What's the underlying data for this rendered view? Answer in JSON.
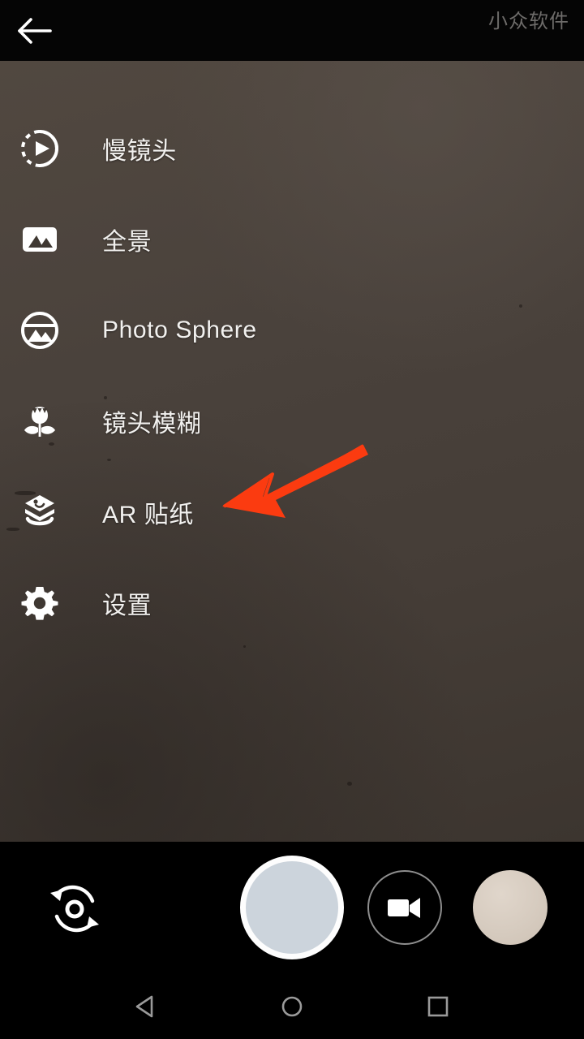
{
  "app": {
    "name": "Camera",
    "screen": "mode-menu"
  },
  "topbar": {
    "back_icon": "arrow-left-icon",
    "watermark": "小众软件"
  },
  "menu": {
    "items": [
      {
        "label": "慢镜头",
        "icon": "slow-motion-icon",
        "name": "menu-item-slow-motion"
      },
      {
        "label": "全景",
        "icon": "panorama-icon",
        "name": "menu-item-panorama"
      },
      {
        "label": "Photo Sphere",
        "icon": "photo-sphere-icon",
        "name": "menu-item-photo-sphere"
      },
      {
        "label": "镜头模糊",
        "icon": "lens-blur-icon",
        "name": "menu-item-lens-blur"
      },
      {
        "label": "AR 贴纸",
        "icon": "ar-stickers-icon",
        "name": "menu-item-ar-stickers"
      },
      {
        "label": "设置",
        "icon": "settings-gear-icon",
        "name": "menu-item-settings"
      }
    ]
  },
  "annotation": {
    "type": "arrow",
    "color": "#fb3b10",
    "points_to": "AR 贴纸",
    "direction": "left-down"
  },
  "camera_controls": {
    "flip_icon": "camera-flip-icon",
    "shutter_label": "",
    "video_icon": "video-camera-icon",
    "thumbnail_label": ""
  },
  "nav_bar": {
    "back_icon": "nav-back-triangle-icon",
    "home_icon": "nav-home-circle-icon",
    "recents_icon": "nav-recents-square-icon"
  },
  "colors": {
    "bar_background": "#050505",
    "menu_background": "#4a423c",
    "label_text": "#f2f1ef",
    "watermark_text": "#6e6c6a",
    "accent_arrow": "#fb3b10",
    "shutter_fill": "#ccd4dc",
    "shutter_ring": "#fdfdfd",
    "thumbnail_fill": "#d6cbbf",
    "nav_icon": "#9a9a9a"
  }
}
